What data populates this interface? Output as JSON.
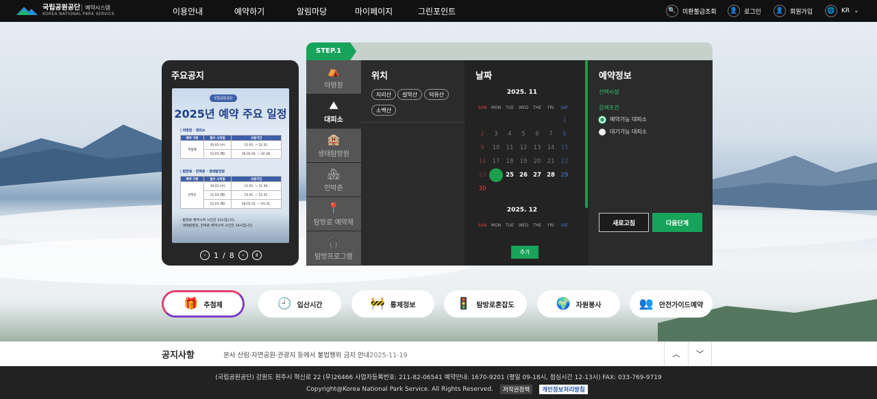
{
  "header": {
    "logo": {
      "name": "국립공원공단",
      "sub": "KOREA NATIONAL PARK SERVICE",
      "system": "예약시스템"
    },
    "nav": [
      "이용안내",
      "예약하기",
      "알림마당",
      "마이페이지",
      "그린포인트"
    ],
    "utils": {
      "unpaid": "미환불금조회",
      "login": "로그인",
      "join": "회원가입",
      "lang": "KR"
    }
  },
  "notice_card": {
    "title": "주요공지",
    "poster": {
      "pill": "국립공원공단",
      "headline": "2025년 예약 주요 일정",
      "section1": "| 야영장 · 대피소",
      "table_head": [
        "예약 구분",
        "접수 시작일",
        "사용기간"
      ],
      "section1_rows": [
        {
          "type": "추첨제",
          "start": "10.01.(수)",
          "period": "11.01. ~ 12.31."
        },
        {
          "type": "",
          "start": "12.01.(월)",
          "period": "26.01.01. ~ 02.28."
        }
      ],
      "section2": "| 탐방로 · 민박촌 · 생태탐방원",
      "section2_rows": [
        {
          "type": "",
          "start": "10.01.(수)",
          "period": "11.01. ~ 11.30."
        },
        {
          "type": "선착순",
          "start": "11.03.(월)",
          "period": "12.01. ~ 12.31."
        },
        {
          "type": "",
          "start": "12.01.(월)",
          "period": "26.01.01. ~ 01.31."
        }
      ],
      "note1": "- 탐방로 예약시작 시간은 10시입니다.",
      "note2": "- 생태탐방원, 민박촌 예약시작 시간은 14시입니다."
    },
    "pager": {
      "current": "1",
      "sep": "/",
      "total": "8"
    }
  },
  "reservation": {
    "step": "STEP.1",
    "tabs": [
      {
        "label": "야영장",
        "icon": "tent-icon",
        "glyph": "⛺"
      },
      {
        "label": "대피소",
        "icon": "shelter-icon",
        "glyph": "⛰"
      },
      {
        "label": "생태탐방원",
        "icon": "building-icon",
        "glyph": "🏨"
      },
      {
        "label": "민박촌",
        "icon": "house-icon",
        "glyph": "🏘"
      },
      {
        "label": "탐방로 예약제",
        "icon": "trail-icon",
        "glyph": "📍"
      },
      {
        "label": "탐방프로그램",
        "icon": "program-icon",
        "glyph": "🎧"
      }
    ],
    "location": {
      "title": "위치",
      "chips": [
        "지리산",
        "설악산",
        "덕유산",
        "소백산"
      ]
    },
    "date": {
      "title": "날짜",
      "month1": "2025. 11",
      "month2": "2025. 12",
      "weekdays": [
        "SUN",
        "MON",
        "TUE",
        "WED",
        "THE",
        "FRI",
        "SAT"
      ],
      "add": "추가"
    },
    "info": {
      "title": "예약정보",
      "facility_label": "선택시설",
      "search_label": "검색조건",
      "radio1": "예약가능 대피소",
      "radio2": "대기가능 대피소",
      "reset": "새로고침",
      "next": "다음단계"
    }
  },
  "quick": [
    {
      "label": "추첨제",
      "icon": "gift-icon",
      "glyph": "🎁"
    },
    {
      "label": "입산시간",
      "icon": "clock-icon",
      "glyph": "🕘"
    },
    {
      "label": "통제정보",
      "icon": "control-icon",
      "glyph": "🚧"
    },
    {
      "label": "탐방로혼잡도",
      "icon": "traffic-icon",
      "glyph": "🚦"
    },
    {
      "label": "자원봉사",
      "icon": "volunteer-icon",
      "glyph": "🌍"
    },
    {
      "label": "안전가이드예약",
      "icon": "guide-icon",
      "glyph": "👥"
    }
  ],
  "notice_bar": {
    "label": "공지사항",
    "text": "본사 산림·자연공원·관광지 등에서 불법행위 금지 안내",
    "date": "2025-11-19"
  },
  "footer": {
    "line1": "(국립공원공단) 강원도 원주시 혁신로 22 (우)26466   사업자등록번호: 211-82-06541   예약안내: 1670-9201 (평일 09-18시, 점심시간 12-13시)   FAX: 033-769-9719",
    "copyright": "Copyright@Korea National Park Service. All Rights Reserved.",
    "policy1": "저작권정책",
    "policy2": "개인정보처리방침"
  }
}
